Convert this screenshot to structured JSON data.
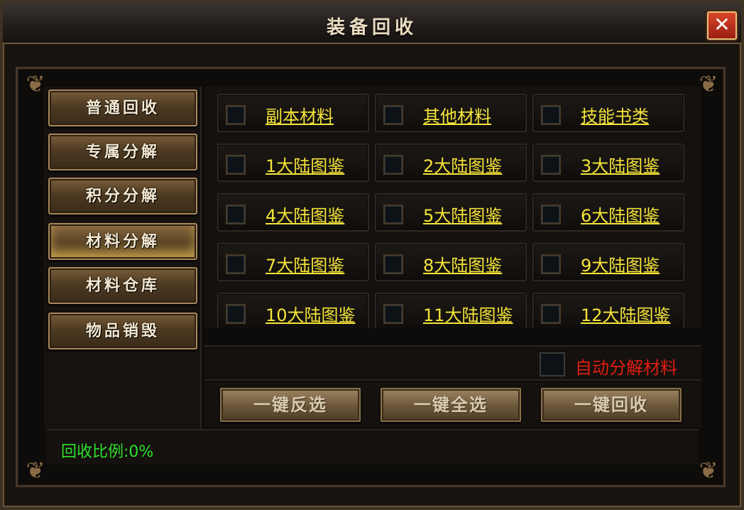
{
  "window": {
    "title": "装备回收",
    "close_label": "✕"
  },
  "sidebar": {
    "items": [
      {
        "label": "普通回收"
      },
      {
        "label": "专属分解"
      },
      {
        "label": "积分分解"
      },
      {
        "label": "材料分解",
        "active": true
      },
      {
        "label": "材料仓库"
      },
      {
        "label": "物品销毁"
      }
    ]
  },
  "grid": {
    "items": [
      {
        "label": "副本材料",
        "checked": false
      },
      {
        "label": "其他材料",
        "checked": false
      },
      {
        "label": "技能书类",
        "checked": false
      },
      {
        "label": "1大陆图鉴",
        "checked": false
      },
      {
        "label": "2大陆图鉴",
        "checked": false
      },
      {
        "label": "3大陆图鉴",
        "checked": false
      },
      {
        "label": "4大陆图鉴",
        "checked": false
      },
      {
        "label": "5大陆图鉴",
        "checked": false
      },
      {
        "label": "6大陆图鉴",
        "checked": false
      },
      {
        "label": "7大陆图鉴",
        "checked": false
      },
      {
        "label": "8大陆图鉴",
        "checked": false
      },
      {
        "label": "9大陆图鉴",
        "checked": false
      },
      {
        "label": "10大陆图鉴",
        "checked": false
      },
      {
        "label": "11大陆图鉴",
        "checked": false
      },
      {
        "label": "12大陆图鉴",
        "checked": false
      }
    ]
  },
  "auto_decompose": {
    "label": "自动分解材料",
    "checked": false
  },
  "actions": {
    "invert_label": "一键反选",
    "select_all_label": "一键全选",
    "recycle_label": "一键回收"
  },
  "status": {
    "ratio_text": "回收比例:0%"
  },
  "colors": {
    "item_text": "#f5e43a",
    "auto_text": "#e11d12",
    "status_text": "#2de02d",
    "title_text": "#e9dcc0"
  }
}
